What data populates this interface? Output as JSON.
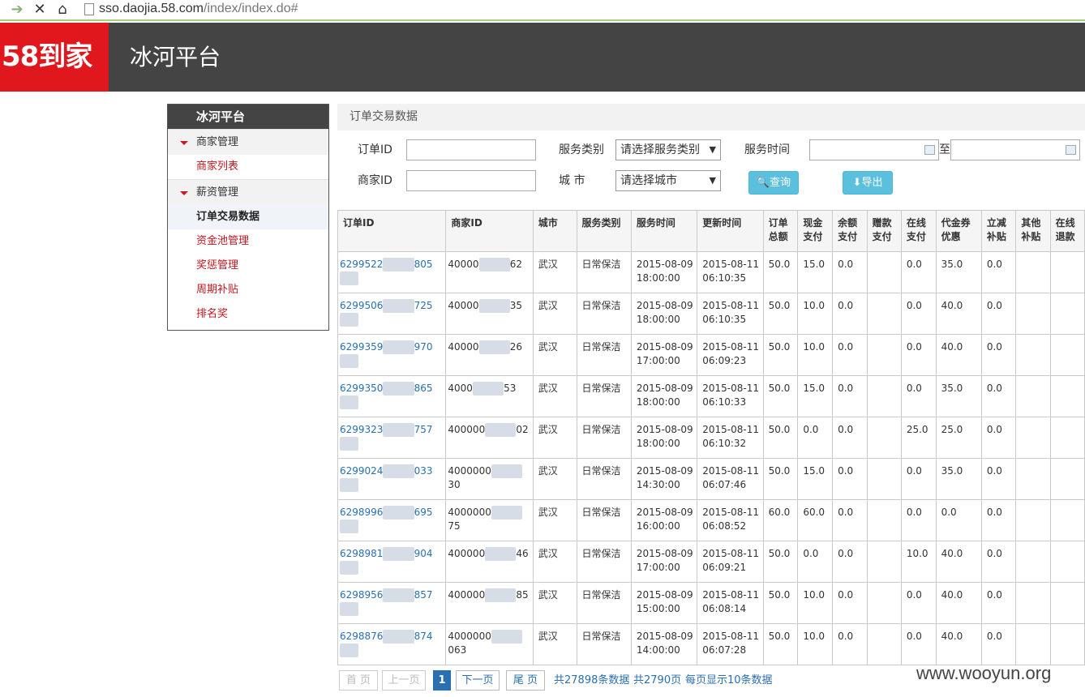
{
  "browser": {
    "url_host": "sso.daojia.58.com",
    "url_path": "/index/index.do#"
  },
  "header": {
    "logo": "58到家",
    "platform": "冰河平台"
  },
  "sidebar": {
    "title": "冰河平台",
    "groups": [
      {
        "label": "商家管理",
        "items": [
          "商家列表"
        ]
      },
      {
        "label": "薪资管理",
        "items": [
          "订单交易数据",
          "资金池管理",
          "奖惩管理",
          "周期补贴",
          "排名奖"
        ]
      }
    ],
    "active": "订单交易数据"
  },
  "panel": {
    "title": "订单交易数据"
  },
  "filters": {
    "order_id_label": "订单ID",
    "merchant_id_label": "商家ID",
    "service_type_label": "服务类别",
    "service_type_value": "请选择服务类别",
    "city_label": "城 市",
    "city_value": "请选择城市",
    "service_time_label": "服务时间",
    "range_sep": "至",
    "query_button": "查询",
    "export_button": "导出"
  },
  "table": {
    "headers": [
      "订单ID",
      "商家ID",
      "城市",
      "服务类别",
      "服务时间",
      "更新时间",
      "订单总额",
      "现金支付",
      "余额支付",
      "赠款支付",
      "在线支付",
      "代金券优惠",
      "立减补贴",
      "其他补贴",
      "在线退款"
    ],
    "rows": [
      {
        "oid_a": "6299522",
        "oid_b": "805",
        "mid_a": "40000",
        "mid_b": "62",
        "city": "武汉",
        "type": "日常保洁",
        "stime_d": "2015-08-09",
        "stime_t": "18:00:00",
        "utime_d": "2015-08-11",
        "utime_t": "06:10:35",
        "total": "50.0",
        "cash": "15.0",
        "balance": "0.0",
        "gift": "",
        "online": "0.0",
        "coupon": "35.0",
        "discount": "0.0",
        "other": "",
        "refund": ""
      },
      {
        "oid_a": "6299506",
        "oid_b": "725",
        "mid_a": "40000",
        "mid_b": "35",
        "city": "武汉",
        "type": "日常保洁",
        "stime_d": "2015-08-09",
        "stime_t": "18:00:00",
        "utime_d": "2015-08-11",
        "utime_t": "06:10:35",
        "total": "50.0",
        "cash": "10.0",
        "balance": "0.0",
        "gift": "",
        "online": "0.0",
        "coupon": "40.0",
        "discount": "0.0",
        "other": "",
        "refund": ""
      },
      {
        "oid_a": "6299359",
        "oid_b": "970",
        "mid_a": "40000",
        "mid_b": "26",
        "city": "武汉",
        "type": "日常保洁",
        "stime_d": "2015-08-09",
        "stime_t": "17:00:00",
        "utime_d": "2015-08-11",
        "utime_t": "06:09:23",
        "total": "50.0",
        "cash": "10.0",
        "balance": "0.0",
        "gift": "",
        "online": "0.0",
        "coupon": "40.0",
        "discount": "0.0",
        "other": "",
        "refund": ""
      },
      {
        "oid_a": "6299350",
        "oid_b": "865",
        "mid_a": "4000",
        "mid_b": "53",
        "city": "武汉",
        "type": "日常保洁",
        "stime_d": "2015-08-09",
        "stime_t": "18:00:00",
        "utime_d": "2015-08-11",
        "utime_t": "06:10:33",
        "total": "50.0",
        "cash": "15.0",
        "balance": "0.0",
        "gift": "",
        "online": "0.0",
        "coupon": "35.0",
        "discount": "0.0",
        "other": "",
        "refund": ""
      },
      {
        "oid_a": "6299323",
        "oid_b": "757",
        "mid_a": "400000",
        "mid_b": "02",
        "city": "武汉",
        "type": "日常保洁",
        "stime_d": "2015-08-09",
        "stime_t": "18:00:00",
        "utime_d": "2015-08-11",
        "utime_t": "06:10:32",
        "total": "50.0",
        "cash": "0.0",
        "balance": "0.0",
        "gift": "",
        "online": "25.0",
        "coupon": "25.0",
        "discount": "0.0",
        "other": "",
        "refund": ""
      },
      {
        "oid_a": "6299024",
        "oid_b": "033",
        "mid_a": "4000000",
        "mid_b": "30",
        "city": "武汉",
        "type": "日常保洁",
        "stime_d": "2015-08-09",
        "stime_t": "14:30:00",
        "utime_d": "2015-08-11",
        "utime_t": "06:07:46",
        "total": "50.0",
        "cash": "15.0",
        "balance": "0.0",
        "gift": "",
        "online": "0.0",
        "coupon": "35.0",
        "discount": "0.0",
        "other": "",
        "refund": ""
      },
      {
        "oid_a": "6298996",
        "oid_b": "695",
        "mid_a": "4000000",
        "mid_b": "75",
        "city": "武汉",
        "type": "日常保洁",
        "stime_d": "2015-08-09",
        "stime_t": "16:00:00",
        "utime_d": "2015-08-11",
        "utime_t": "06:08:52",
        "total": "60.0",
        "cash": "60.0",
        "balance": "0.0",
        "gift": "",
        "online": "0.0",
        "coupon": "0.0",
        "discount": "0.0",
        "other": "",
        "refund": ""
      },
      {
        "oid_a": "6298981",
        "oid_b": "904",
        "mid_a": "400000",
        "mid_b": "46",
        "city": "武汉",
        "type": "日常保洁",
        "stime_d": "2015-08-09",
        "stime_t": "17:00:00",
        "utime_d": "2015-08-11",
        "utime_t": "06:09:21",
        "total": "50.0",
        "cash": "0.0",
        "balance": "0.0",
        "gift": "",
        "online": "10.0",
        "coupon": "40.0",
        "discount": "0.0",
        "other": "",
        "refund": ""
      },
      {
        "oid_a": "6298956",
        "oid_b": "857",
        "mid_a": "400000",
        "mid_b": "85",
        "city": "武汉",
        "type": "日常保洁",
        "stime_d": "2015-08-09",
        "stime_t": "15:00:00",
        "utime_d": "2015-08-11",
        "utime_t": "06:08:14",
        "total": "50.0",
        "cash": "10.0",
        "balance": "0.0",
        "gift": "",
        "online": "0.0",
        "coupon": "40.0",
        "discount": "0.0",
        "other": "",
        "refund": ""
      },
      {
        "oid_a": "6298876",
        "oid_b": "874",
        "mid_a": "4000000",
        "mid_b": "063",
        "city": "武汉",
        "type": "日常保洁",
        "stime_d": "2015-08-09",
        "stime_t": "14:00:00",
        "utime_d": "2015-08-11",
        "utime_t": "06:07:28",
        "total": "50.0",
        "cash": "10.0",
        "balance": "0.0",
        "gift": "",
        "online": "0.0",
        "coupon": "40.0",
        "discount": "0.0",
        "other": "",
        "refund": ""
      }
    ]
  },
  "pager": {
    "first": "首 页",
    "prev": "上一页",
    "current": "1",
    "next": "下一页",
    "last": "尾 页",
    "total_records": "共27898条数据",
    "total_pages": "共2790页",
    "per_page": "每页显示10条数据"
  },
  "watermark": "www.wooyun.org"
}
